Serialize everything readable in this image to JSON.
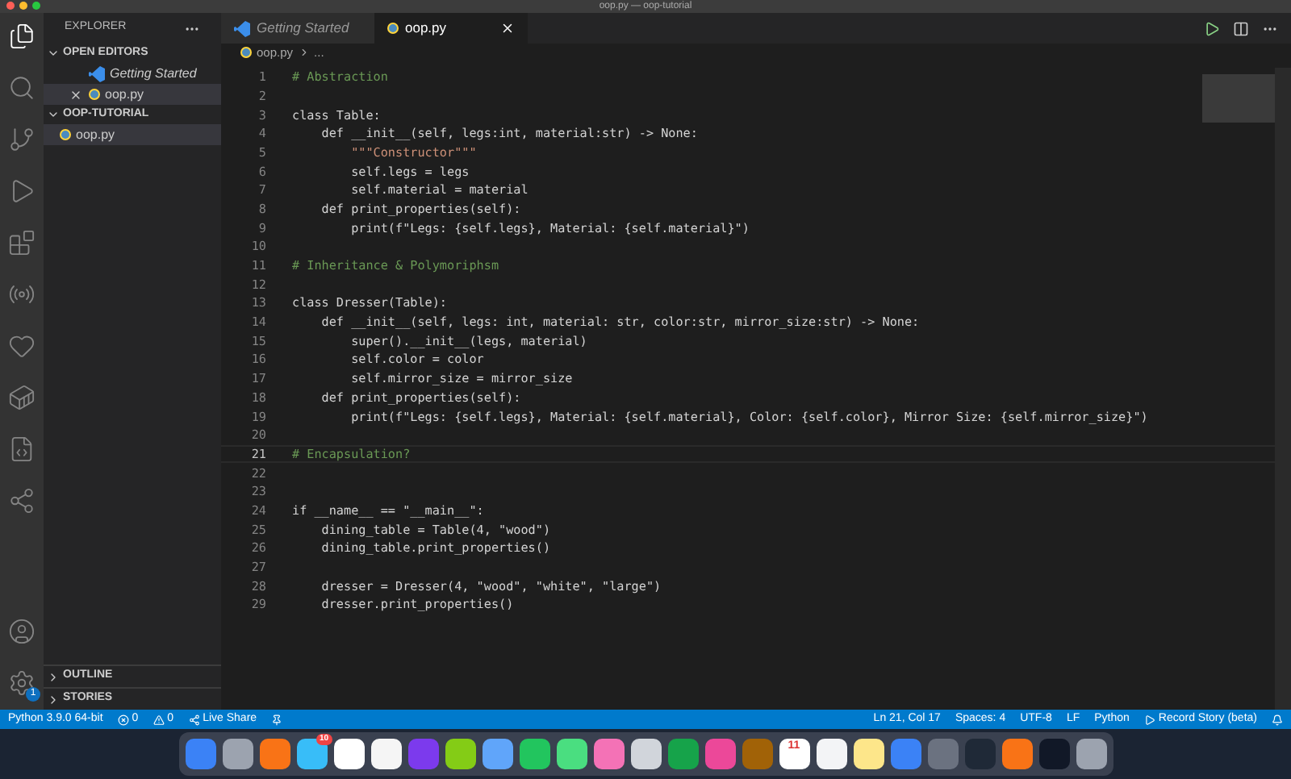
{
  "window": {
    "title": "oop.py — oop-tutorial"
  },
  "sidebar": {
    "title": "EXPLORER",
    "sections": [
      {
        "title": "OPEN EDITORS",
        "expanded": true,
        "items": [
          {
            "label": "Getting Started",
            "kind": "vscode",
            "selected": false
          },
          {
            "label": "oop.py",
            "kind": "python",
            "selected": true
          }
        ]
      },
      {
        "title": "OOP-TUTORIAL",
        "expanded": true,
        "items": [
          {
            "label": "oop.py",
            "kind": "python",
            "selected": true
          }
        ]
      }
    ],
    "bottom_sections": [
      {
        "title": "OUTLINE",
        "expanded": false
      },
      {
        "title": "STORIES",
        "expanded": false
      }
    ]
  },
  "settings_badge": "1",
  "tabs": [
    {
      "label": "Getting Started",
      "kind": "vscode",
      "selected": false
    },
    {
      "label": "oop.py",
      "kind": "python",
      "selected": true
    }
  ],
  "breadcrumb": [
    "oop.py",
    "..."
  ],
  "code": [
    {
      "num": "1",
      "kind": "comment",
      "text": "# Abstraction"
    },
    {
      "num": "2"
    },
    {
      "num": "3",
      "kind": "code",
      "text": "class Table:"
    },
    {
      "num": "4",
      "kind": "code",
      "text": "    def __init__(self, legs:int, material:str) -> None:"
    },
    {
      "num": "5",
      "kind": "string",
      "text": "        \"\"\"Constructor\"\"\""
    },
    {
      "num": "6",
      "kind": "code",
      "text": "        self.legs = legs"
    },
    {
      "num": "7",
      "kind": "code",
      "text": "        self.material = material"
    },
    {
      "num": "8",
      "kind": "code",
      "text": "    def print_properties(self):"
    },
    {
      "num": "9",
      "kind": "code",
      "text": "        print(f\"Legs: {self.legs}, Material: {self.material}\")"
    },
    {
      "num": "10"
    },
    {
      "num": "11",
      "kind": "comment",
      "text": "# Inheritance & Polymoriphsm"
    },
    {
      "num": "12"
    },
    {
      "num": "13",
      "kind": "code",
      "text": "class Dresser(Table):"
    },
    {
      "num": "14",
      "kind": "code",
      "text": "    def __init__(self, legs: int, material: str, color:str, mirror_size:str) -> None:"
    },
    {
      "num": "15",
      "kind": "code",
      "text": "        super().__init__(legs, material)"
    },
    {
      "num": "16",
      "kind": "code",
      "text": "        self.color = color"
    },
    {
      "num": "17",
      "kind": "code",
      "text": "        self.mirror_size = mirror_size"
    },
    {
      "num": "18",
      "kind": "code",
      "text": "    def print_properties(self):"
    },
    {
      "num": "19",
      "kind": "code",
      "text": "        print(f\"Legs: {self.legs}, Material: {self.material}, Color: {self.color}, Mirror Size: {self.mirror_size}\")"
    },
    {
      "num": "20"
    },
    {
      "num": "21",
      "kind": "comment",
      "text": "# Encapsulation?",
      "selected": true
    },
    {
      "num": "22"
    },
    {
      "num": "23"
    },
    {
      "num": "24",
      "kind": "code",
      "text": "if __name__ == \"__main__\":"
    },
    {
      "num": "25",
      "kind": "code",
      "text": "    dining_table = Table(4, \"wood\")"
    },
    {
      "num": "26",
      "kind": "code",
      "text": "    dining_table.print_properties()"
    },
    {
      "num": "27"
    },
    {
      "num": "28",
      "kind": "code",
      "text": "    dresser = Dresser(4, \"wood\", \"white\", \"large\")"
    },
    {
      "num": "29",
      "kind": "code",
      "text": "    dresser.print_properties()"
    }
  ],
  "status_bar": {
    "left": [
      {
        "label": "Python 3.9.0 64-bit",
        "kind": "text"
      },
      {
        "label": "0",
        "kind": "errors"
      },
      {
        "label": "0",
        "kind": "warnings"
      },
      {
        "label": "Live Share",
        "kind": "share"
      },
      {
        "kind": "pin"
      }
    ],
    "right": [
      {
        "label": "Ln 21, Col 17",
        "kind": "text"
      },
      {
        "label": "Spaces: 4",
        "kind": "text"
      },
      {
        "label": "UTF-8",
        "kind": "text"
      },
      {
        "label": "LF",
        "kind": "text"
      },
      {
        "label": "Python",
        "kind": "text"
      },
      {
        "label": "Record Story (beta)",
        "kind": "play"
      }
    ]
  },
  "dock": [
    {
      "color": "#3b82f6"
    },
    {
      "color": "#9ca3af"
    },
    {
      "color": "#f97316"
    },
    {
      "color": "#38bdf8",
      "badge": "10"
    },
    {
      "color": "#ffffff"
    },
    {
      "color": "#f5f5f5"
    },
    {
      "color": "#7c3aed"
    },
    {
      "color": "#84cc16"
    },
    {
      "color": "#60a5fa"
    },
    {
      "color": "#22c55e"
    },
    {
      "color": "#4ade80"
    },
    {
      "color": "#f472b6"
    },
    {
      "color": "#d1d5db"
    },
    {
      "color": "#16a34a"
    },
    {
      "color": "#ec4899"
    },
    {
      "color": "#a16207"
    },
    {
      "color": "#ffffff",
      "label": "11"
    },
    {
      "color": "#f3f4f6"
    },
    {
      "color": "#fde68a"
    },
    {
      "color": "#3b82f6"
    },
    {
      "color": "#6b7280"
    },
    {
      "color": "#1f2937"
    },
    {
      "color": "#f97316"
    },
    {
      "color": "#111827"
    },
    {
      "color": "#9ca3af"
    }
  ]
}
